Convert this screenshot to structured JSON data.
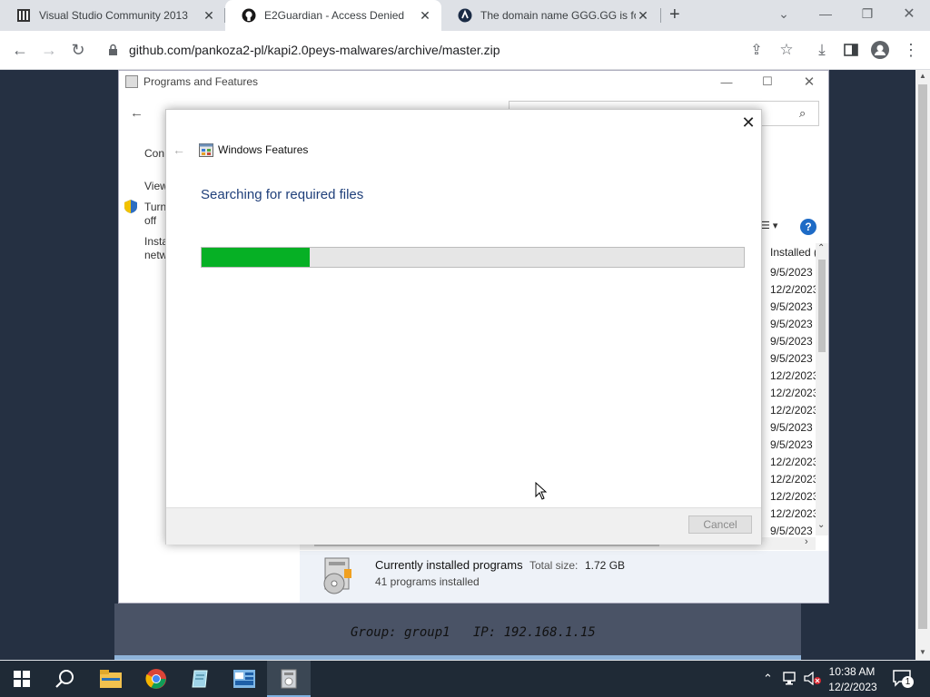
{
  "browser": {
    "tabs": [
      {
        "title": "Visual Studio Community 2013 ",
        "favicon": "visual-studio-icon",
        "active": false
      },
      {
        "title": "E2Guardian - Access Denied",
        "favicon": "github-icon",
        "active": true
      },
      {
        "title": "The domain name GGG.GG is fo",
        "favicon": "domain-site-icon",
        "active": false
      }
    ],
    "new_tab": "+",
    "url": "github.com/pankoza2-pl/kapi2.0peys-malwares/archive/master.zip"
  },
  "remote_desktop": {
    "group_label": "Group: group1   IP: 192.168.1.15"
  },
  "programs_window": {
    "title": "Programs and Features",
    "sidebar": {
      "link1": "Con",
      "link2": "View",
      "link3_line1": "Turn",
      "link3_line2": "off",
      "link4_line1": "Insta",
      "link4_line2": "netw"
    },
    "column_installed": "Installed (",
    "dates": [
      "9/5/2023",
      "12/2/2023",
      "9/5/2023",
      "9/5/2023",
      "9/5/2023",
      "9/5/2023",
      "12/2/2023",
      "12/2/2023",
      "12/2/2023",
      "9/5/2023",
      "9/5/2023",
      "12/2/2023",
      "12/2/2023",
      "12/2/2023",
      "12/2/2023",
      "9/5/2023"
    ],
    "help": "?",
    "status": {
      "title": "Currently installed programs",
      "size_label": "Total size:",
      "size_value": "1.72 GB",
      "count": "41 programs installed"
    }
  },
  "features_dialog": {
    "title": "Windows Features",
    "heading": "Searching for required files",
    "progress": 0.2,
    "cancel_label": "Cancel"
  },
  "taskbar": {
    "time": "10:38 AM",
    "date": "12/2/2023",
    "notification_count": "1",
    "apps": [
      "start-icon",
      "search-icon",
      "file-explorer-icon",
      "chrome-icon",
      "notepad-icon",
      "control-panel-icon",
      "programs-features-icon"
    ]
  },
  "colors": {
    "progress_fill": "#06b025",
    "dialog_heading": "#1f3f7a",
    "taskbar": "#1f2a36"
  }
}
